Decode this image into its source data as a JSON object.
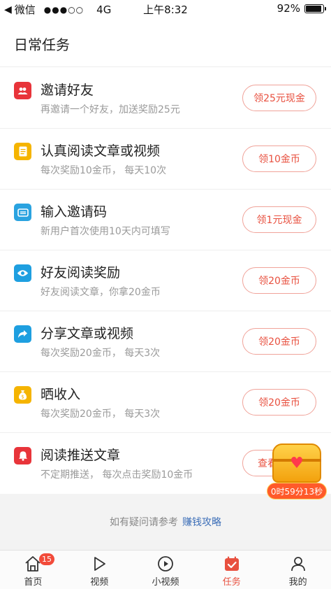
{
  "status_bar": {
    "back_app": "微信",
    "signal_dots": "●●●○○",
    "network": "4G",
    "time": "上午8:32",
    "battery": "92%",
    "battery_level": 0.92
  },
  "header": {
    "title": "日常任务"
  },
  "tasks": [
    {
      "title": "邀请好友",
      "subtitle": "再邀请一个好友，加送奖励25元",
      "button": "领25元现金",
      "icon": "users-icon",
      "icon_color": "#e8343a",
      "icon_glyph": "👥"
    },
    {
      "title": "认真阅读文章或视频",
      "subtitle": "每次奖励10金币，  每天10次",
      "button": "领10金币",
      "icon": "document-icon",
      "icon_color": "#f5b400",
      "icon_glyph": "▤"
    },
    {
      "title": "输入邀请码",
      "subtitle": "新用户首次使用10天内可填写",
      "button": "领1元现金",
      "icon": "ticket-icon",
      "icon_color": "#2aa3e0",
      "icon_glyph": "▭"
    },
    {
      "title": "好友阅读奖励",
      "subtitle": "好友阅读文章，你拿20金币",
      "button": "领20金币",
      "icon": "eye-icon",
      "icon_color": "#1e9fe0",
      "icon_glyph": "◉"
    },
    {
      "title": "分享文章或视频",
      "subtitle": "每次奖励20金币，  每天3次",
      "button": "领20金币",
      "icon": "share-icon",
      "icon_color": "#1e9fe0",
      "icon_glyph": "➦"
    },
    {
      "title": "晒收入",
      "subtitle": "每次奖励20金币，  每天3次",
      "button": "领20金币",
      "icon": "money-bag-icon",
      "icon_color": "#f5b400",
      "icon_glyph": "$"
    },
    {
      "title": "阅读推送文章",
      "subtitle": "不定期推送，  每次点击奖励10金币",
      "button": "查看",
      "icon": "bell-icon",
      "icon_color": "#e8343a",
      "icon_glyph": "🔔"
    }
  ],
  "footer": {
    "note": "如有疑问请参考",
    "link": "赚钱攻略"
  },
  "chest": {
    "timer": "0时59分13秒"
  },
  "tabs": [
    {
      "label": "首页",
      "icon": "home-icon",
      "badge": "15",
      "active": false
    },
    {
      "label": "视频",
      "icon": "play-icon",
      "active": false
    },
    {
      "label": "小视频",
      "icon": "short-video-icon",
      "active": false
    },
    {
      "label": "任务",
      "icon": "calendar-check-icon",
      "active": true
    },
    {
      "label": "我的",
      "icon": "profile-icon",
      "active": false
    }
  ],
  "colors": {
    "accent": "#e8503f",
    "link": "#3d6fb8"
  }
}
